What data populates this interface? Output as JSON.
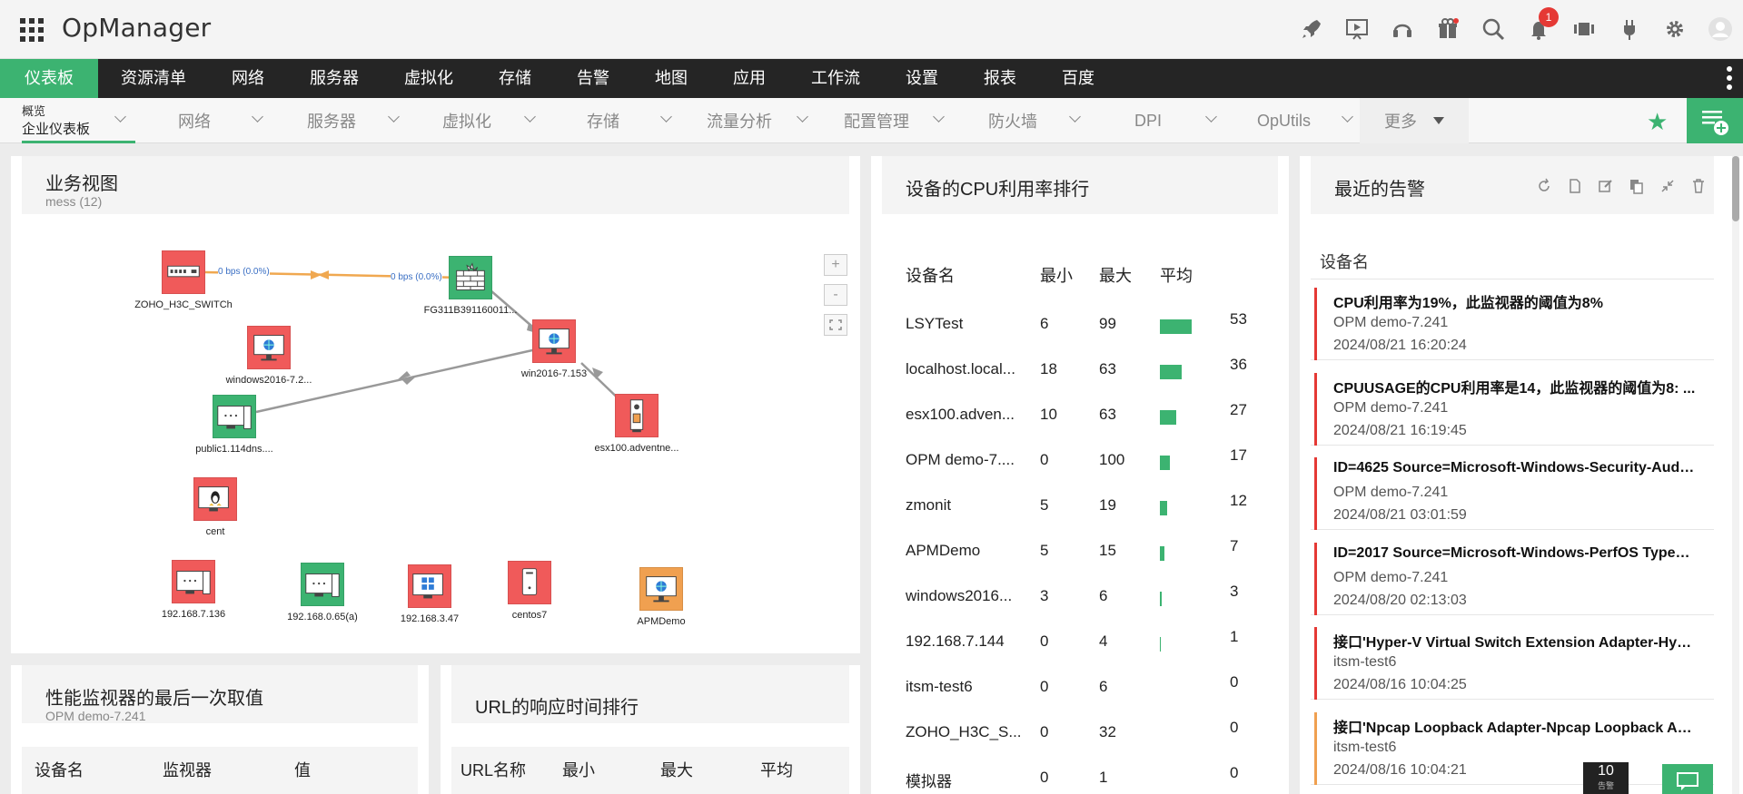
{
  "app": {
    "brand": "OpManager",
    "notifications": "1"
  },
  "mainnav": [
    "仪表板",
    "资源清单",
    "网络",
    "服务器",
    "虚拟化",
    "存储",
    "告警",
    "地图",
    "应用",
    "工作流",
    "设置",
    "报表",
    "百度"
  ],
  "subnav": {
    "first_top": "概览",
    "first_bottom": "企业仪表板",
    "items": [
      "网络",
      "服务器",
      "虚拟化",
      "存储",
      "流量分析",
      "配置管理",
      "防火墙",
      "DPI",
      "OpUtils"
    ],
    "more": "更多"
  },
  "business_view": {
    "title": "业务视图",
    "subtitle": "mess (12)",
    "zoom_in": "+",
    "zoom_out": "-",
    "link_label_1": "0 bps (0.0%)",
    "link_label_2": "0 bps (0.0%)",
    "nodes": [
      {
        "label": "ZOHO_H3C_SWITCh",
        "color": "#f05a5a",
        "icon": "switch-icon"
      },
      {
        "label": "FG311B391160011...",
        "color": "#3cb371",
        "icon": "firewall-icon"
      },
      {
        "label": "windows2016-7.2...",
        "color": "#f05a5a",
        "icon": "windows-server-icon"
      },
      {
        "label": "win2016-7.153",
        "color": "#f05a5a",
        "icon": "windows-server-icon"
      },
      {
        "label": "public1.114dns....",
        "color": "#3cb371",
        "icon": "server-icon"
      },
      {
        "label": "esx100.adventne...",
        "color": "#f05a5a",
        "icon": "esx-icon"
      },
      {
        "label": "cent",
        "color": "#f05a5a",
        "icon": "linux-icon"
      },
      {
        "label": "192.168.7.136",
        "color": "#f05a5a",
        "icon": "server-icon"
      },
      {
        "label": "192.168.0.65(a)",
        "color": "#3cb371",
        "icon": "server-icon"
      },
      {
        "label": "192.168.3.47",
        "color": "#f05a5a",
        "icon": "windows-icon"
      },
      {
        "label": "centos7",
        "color": "#f05a5a",
        "icon": "tower-icon"
      },
      {
        "label": "APMDemo",
        "color": "#f0a050",
        "icon": "windows-server-icon"
      }
    ]
  },
  "cpu": {
    "title": "设备的CPU利用率排行",
    "columns": [
      "设备名",
      "最小",
      "最大",
      "平均"
    ],
    "rows": [
      {
        "name": "LSYTest",
        "min": "6",
        "max": "99",
        "avg": "53",
        "avg_pct": 53
      },
      {
        "name": "localhost.local...",
        "min": "18",
        "max": "63",
        "avg": "36",
        "avg_pct": 36
      },
      {
        "name": "esx100.adven...",
        "min": "10",
        "max": "63",
        "avg": "27",
        "avg_pct": 27
      },
      {
        "name": "OPM demo-7....",
        "min": "0",
        "max": "100",
        "avg": "17",
        "avg_pct": 17
      },
      {
        "name": "zmonit",
        "min": "5",
        "max": "19",
        "avg": "12",
        "avg_pct": 12
      },
      {
        "name": "APMDemo",
        "min": "5",
        "max": "15",
        "avg": "7",
        "avg_pct": 7
      },
      {
        "name": "windows2016...",
        "min": "3",
        "max": "6",
        "avg": "3",
        "avg_pct": 3
      },
      {
        "name": "192.168.7.144",
        "min": "0",
        "max": "4",
        "avg": "1",
        "avg_pct": 1
      },
      {
        "name": "itsm-test6",
        "min": "0",
        "max": "6",
        "avg": "0",
        "avg_pct": 0
      },
      {
        "name": "ZOHO_H3C_S...",
        "min": "0",
        "max": "32",
        "avg": "0",
        "avg_pct": 0
      },
      {
        "name": "模拟器",
        "min": "0",
        "max": "1",
        "avg": "0",
        "avg_pct": 0
      }
    ]
  },
  "alarms": {
    "title": "最近的告警",
    "column": "设备名",
    "items": [
      {
        "msg": "CPU利用率为19%，此监视器的阈值为8%",
        "device": "OPM demo-7.241",
        "time": "2024/08/21 16:20:24",
        "severity_color": "#e53935"
      },
      {
        "msg": "CPUUSAGE的CPU利用率是14，此监视器的阈值为8: ...",
        "device": "OPM demo-7.241",
        "time": "2024/08/21 16:19:45",
        "severity_color": "#e53935"
      },
      {
        "msg": "ID=4625 Source=Microsoft-Windows-Security-Auditi...",
        "device": "OPM demo-7.241",
        "time": "2024/08/21 03:01:59",
        "severity_color": "#e53935"
      },
      {
        "msg": "ID=2017 Source=Microsoft-Windows-PerfOS Type=2 ...",
        "device": "OPM demo-7.241",
        "time": "2024/08/20 02:13:03",
        "severity_color": "#e53935"
      },
      {
        "msg": "接口'Hyper-V Virtual Switch Extension Adapter-Hyper...",
        "device": "itsm-test6",
        "time": "2024/08/16 10:04:25",
        "severity_color": "#e53935"
      },
      {
        "msg": "接口'Npcap Loopback Adapter-Npcap Loopback Adapt...",
        "device": "itsm-test6",
        "time": "2024/08/16 10:04:21",
        "severity_color": "#f0a050"
      }
    ],
    "alarm_count": "10",
    "alarm_count_label": "告警"
  },
  "perf": {
    "title": "性能监视器的最后一次取值",
    "subtitle": "OPM demo-7.241",
    "columns": [
      "设备名",
      "监视器",
      "值"
    ]
  },
  "url": {
    "title": "URL的响应时间排行",
    "columns": [
      "URL名称",
      "最小",
      "最大",
      "平均"
    ]
  },
  "colors": {
    "accent": "#3cb371",
    "critical": "#e53935",
    "warning": "#f0a050",
    "nav_bg": "#252525"
  }
}
